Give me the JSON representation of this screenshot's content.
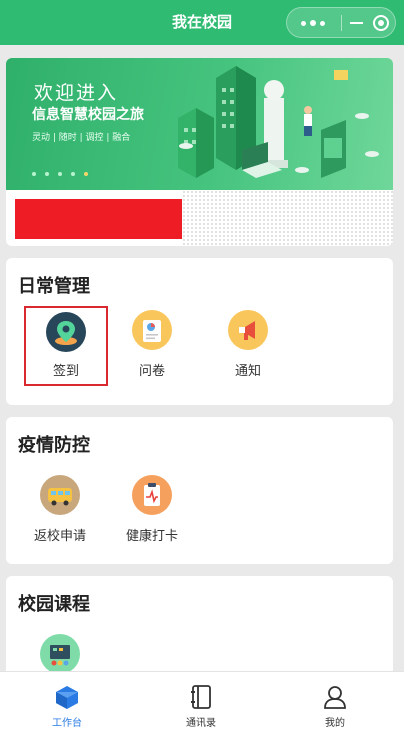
{
  "header": {
    "title": "我在校园"
  },
  "banner": {
    "line1": "欢迎进入",
    "line2": "信息智慧校园之旅",
    "line3": "灵动 | 随时 | 调控 | 融合"
  },
  "sections": [
    {
      "title": "日常管理",
      "items": [
        {
          "label": "签到",
          "icon": "location-pin-icon",
          "selected": true
        },
        {
          "label": "问卷",
          "icon": "questionnaire-icon"
        },
        {
          "label": "通知",
          "icon": "megaphone-icon"
        }
      ]
    },
    {
      "title": "疫情防控",
      "items": [
        {
          "label": "返校申请",
          "icon": "school-bus-icon"
        },
        {
          "label": "健康打卡",
          "icon": "health-clipboard-icon"
        }
      ]
    },
    {
      "title": "校园课程",
      "items": [
        {
          "label": "",
          "icon": "classroom-board-icon"
        }
      ]
    }
  ],
  "tabbar": [
    {
      "label": "工作台",
      "icon": "cube-icon",
      "active": true
    },
    {
      "label": "通讯录",
      "icon": "address-book-icon"
    },
    {
      "label": "我的",
      "icon": "person-icon"
    }
  ],
  "colors": {
    "brand": "#2fbb72",
    "accent": "#2a7be4",
    "selection": "#d9282f",
    "redaction": "#ee1c25"
  }
}
